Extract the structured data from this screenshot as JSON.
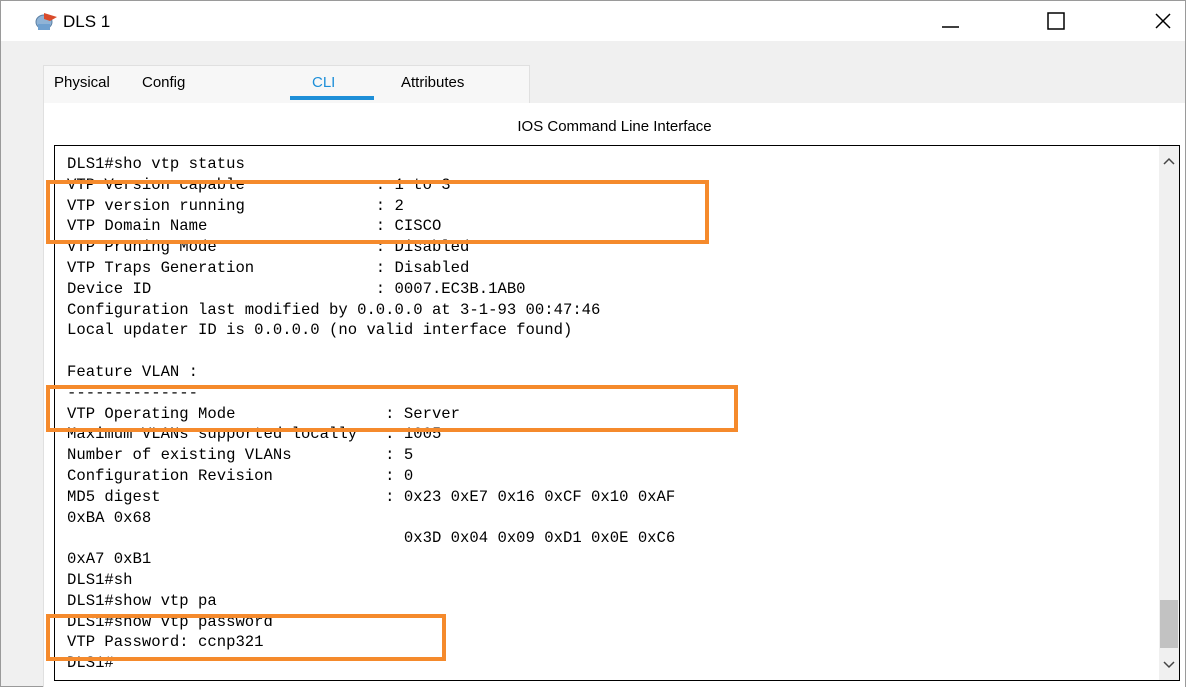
{
  "window": {
    "title": "DLS 1",
    "colors": {
      "accent": "#1e8fd8",
      "highlight": "#f58a2c"
    }
  },
  "tabs": [
    {
      "label": "Physical",
      "active": false
    },
    {
      "label": "Config",
      "active": false
    },
    {
      "label": "CLI",
      "active": true
    },
    {
      "label": "Attributes",
      "active": false
    }
  ],
  "section_title": "IOS Command Line Interface",
  "console": {
    "text": "DLS1#sho vtp status\nVTP Version capable              : 1 to 3\nVTP version running              : 2\nVTP Domain Name                  : CISCO\nVTP Pruning Mode                 : Disabled\nVTP Traps Generation             : Disabled\nDevice ID                        : 0007.EC3B.1AB0\nConfiguration last modified by 0.0.0.0 at 3-1-93 00:47:46\nLocal updater ID is 0.0.0.0 (no valid interface found)\n\nFeature VLAN :\n--------------\nVTP Operating Mode                : Server\nMaximum VLANs supported locally   : 1005\nNumber of existing VLANs          : 5\nConfiguration Revision            : 0\nMD5 digest                        : 0x23 0xE7 0x16 0xCF 0x10 0xAF\n0xBA 0x68\n                                    0x3D 0x04 0x09 0xD1 0x0E 0xC6\n0xA7 0xB1\nDLS1#sh\nDLS1#show vtp pa\nDLS1#show vtp password\nVTP Password: ccnp321\nDLS1#"
  }
}
